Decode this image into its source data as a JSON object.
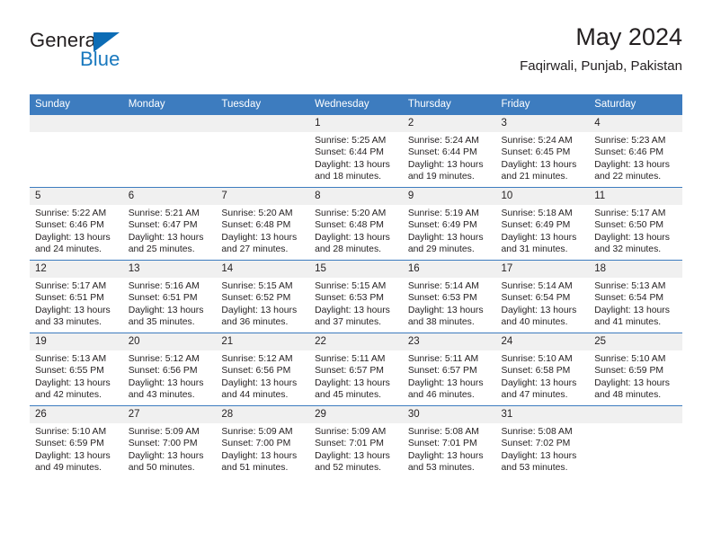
{
  "brand": {
    "name_part1": "General",
    "name_part2": "Blue",
    "triangle_color": "#0c6cb5",
    "blue_color": "#1878be"
  },
  "header": {
    "title": "May 2024",
    "subtitle": "Faqirwali, Punjab, Pakistan",
    "accent_color": "#3d7cbf"
  },
  "weekday_headers": [
    "Sunday",
    "Monday",
    "Tuesday",
    "Wednesday",
    "Thursday",
    "Friday",
    "Saturday"
  ],
  "weeks": [
    [
      {
        "day": "",
        "empty": true
      },
      {
        "day": "",
        "empty": true
      },
      {
        "day": "",
        "empty": true
      },
      {
        "day": "1",
        "sunrise": "Sunrise: 5:25 AM",
        "sunset": "Sunset: 6:44 PM",
        "daylight": "Daylight: 13 hours and 18 minutes."
      },
      {
        "day": "2",
        "sunrise": "Sunrise: 5:24 AM",
        "sunset": "Sunset: 6:44 PM",
        "daylight": "Daylight: 13 hours and 19 minutes."
      },
      {
        "day": "3",
        "sunrise": "Sunrise: 5:24 AM",
        "sunset": "Sunset: 6:45 PM",
        "daylight": "Daylight: 13 hours and 21 minutes."
      },
      {
        "day": "4",
        "sunrise": "Sunrise: 5:23 AM",
        "sunset": "Sunset: 6:46 PM",
        "daylight": "Daylight: 13 hours and 22 minutes."
      }
    ],
    [
      {
        "day": "5",
        "sunrise": "Sunrise: 5:22 AM",
        "sunset": "Sunset: 6:46 PM",
        "daylight": "Daylight: 13 hours and 24 minutes."
      },
      {
        "day": "6",
        "sunrise": "Sunrise: 5:21 AM",
        "sunset": "Sunset: 6:47 PM",
        "daylight": "Daylight: 13 hours and 25 minutes."
      },
      {
        "day": "7",
        "sunrise": "Sunrise: 5:20 AM",
        "sunset": "Sunset: 6:48 PM",
        "daylight": "Daylight: 13 hours and 27 minutes."
      },
      {
        "day": "8",
        "sunrise": "Sunrise: 5:20 AM",
        "sunset": "Sunset: 6:48 PM",
        "daylight": "Daylight: 13 hours and 28 minutes."
      },
      {
        "day": "9",
        "sunrise": "Sunrise: 5:19 AM",
        "sunset": "Sunset: 6:49 PM",
        "daylight": "Daylight: 13 hours and 29 minutes."
      },
      {
        "day": "10",
        "sunrise": "Sunrise: 5:18 AM",
        "sunset": "Sunset: 6:49 PM",
        "daylight": "Daylight: 13 hours and 31 minutes."
      },
      {
        "day": "11",
        "sunrise": "Sunrise: 5:17 AM",
        "sunset": "Sunset: 6:50 PM",
        "daylight": "Daylight: 13 hours and 32 minutes."
      }
    ],
    [
      {
        "day": "12",
        "sunrise": "Sunrise: 5:17 AM",
        "sunset": "Sunset: 6:51 PM",
        "daylight": "Daylight: 13 hours and 33 minutes."
      },
      {
        "day": "13",
        "sunrise": "Sunrise: 5:16 AM",
        "sunset": "Sunset: 6:51 PM",
        "daylight": "Daylight: 13 hours and 35 minutes."
      },
      {
        "day": "14",
        "sunrise": "Sunrise: 5:15 AM",
        "sunset": "Sunset: 6:52 PM",
        "daylight": "Daylight: 13 hours and 36 minutes."
      },
      {
        "day": "15",
        "sunrise": "Sunrise: 5:15 AM",
        "sunset": "Sunset: 6:53 PM",
        "daylight": "Daylight: 13 hours and 37 minutes."
      },
      {
        "day": "16",
        "sunrise": "Sunrise: 5:14 AM",
        "sunset": "Sunset: 6:53 PM",
        "daylight": "Daylight: 13 hours and 38 minutes."
      },
      {
        "day": "17",
        "sunrise": "Sunrise: 5:14 AM",
        "sunset": "Sunset: 6:54 PM",
        "daylight": "Daylight: 13 hours and 40 minutes."
      },
      {
        "day": "18",
        "sunrise": "Sunrise: 5:13 AM",
        "sunset": "Sunset: 6:54 PM",
        "daylight": "Daylight: 13 hours and 41 minutes."
      }
    ],
    [
      {
        "day": "19",
        "sunrise": "Sunrise: 5:13 AM",
        "sunset": "Sunset: 6:55 PM",
        "daylight": "Daylight: 13 hours and 42 minutes."
      },
      {
        "day": "20",
        "sunrise": "Sunrise: 5:12 AM",
        "sunset": "Sunset: 6:56 PM",
        "daylight": "Daylight: 13 hours and 43 minutes."
      },
      {
        "day": "21",
        "sunrise": "Sunrise: 5:12 AM",
        "sunset": "Sunset: 6:56 PM",
        "daylight": "Daylight: 13 hours and 44 minutes."
      },
      {
        "day": "22",
        "sunrise": "Sunrise: 5:11 AM",
        "sunset": "Sunset: 6:57 PM",
        "daylight": "Daylight: 13 hours and 45 minutes."
      },
      {
        "day": "23",
        "sunrise": "Sunrise: 5:11 AM",
        "sunset": "Sunset: 6:57 PM",
        "daylight": "Daylight: 13 hours and 46 minutes."
      },
      {
        "day": "24",
        "sunrise": "Sunrise: 5:10 AM",
        "sunset": "Sunset: 6:58 PM",
        "daylight": "Daylight: 13 hours and 47 minutes."
      },
      {
        "day": "25",
        "sunrise": "Sunrise: 5:10 AM",
        "sunset": "Sunset: 6:59 PM",
        "daylight": "Daylight: 13 hours and 48 minutes."
      }
    ],
    [
      {
        "day": "26",
        "sunrise": "Sunrise: 5:10 AM",
        "sunset": "Sunset: 6:59 PM",
        "daylight": "Daylight: 13 hours and 49 minutes."
      },
      {
        "day": "27",
        "sunrise": "Sunrise: 5:09 AM",
        "sunset": "Sunset: 7:00 PM",
        "daylight": "Daylight: 13 hours and 50 minutes."
      },
      {
        "day": "28",
        "sunrise": "Sunrise: 5:09 AM",
        "sunset": "Sunset: 7:00 PM",
        "daylight": "Daylight: 13 hours and 51 minutes."
      },
      {
        "day": "29",
        "sunrise": "Sunrise: 5:09 AM",
        "sunset": "Sunset: 7:01 PM",
        "daylight": "Daylight: 13 hours and 52 minutes."
      },
      {
        "day": "30",
        "sunrise": "Sunrise: 5:08 AM",
        "sunset": "Sunset: 7:01 PM",
        "daylight": "Daylight: 13 hours and 53 minutes."
      },
      {
        "day": "31",
        "sunrise": "Sunrise: 5:08 AM",
        "sunset": "Sunset: 7:02 PM",
        "daylight": "Daylight: 13 hours and 53 minutes."
      },
      {
        "day": "",
        "empty": true
      }
    ]
  ]
}
